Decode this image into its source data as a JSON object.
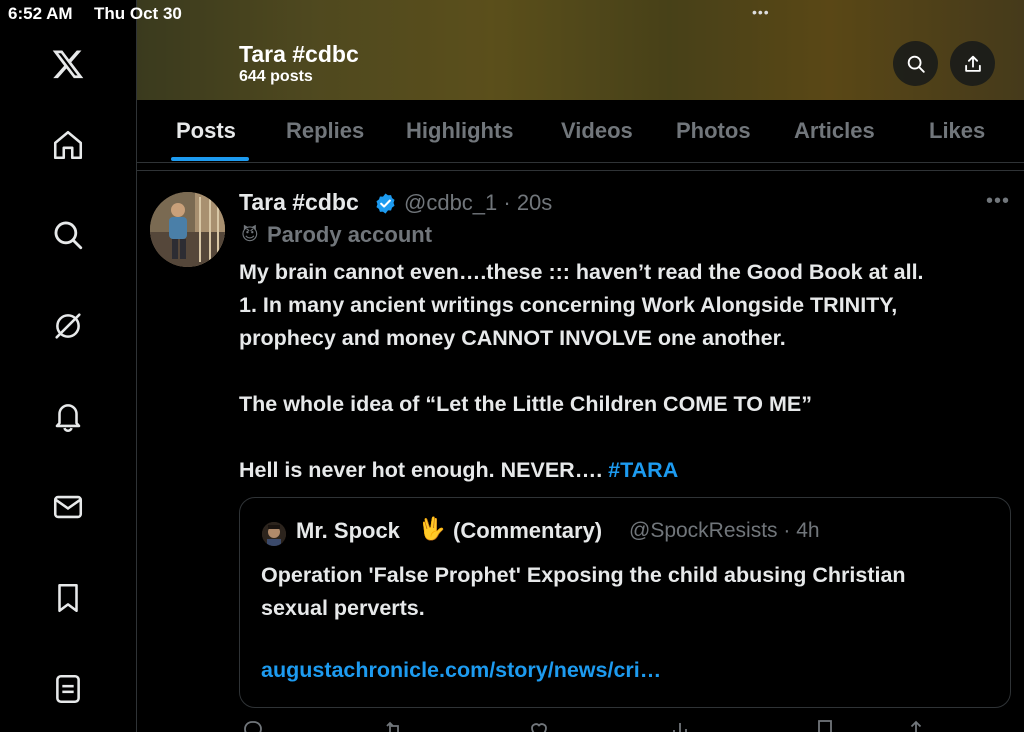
{
  "status_bar": {
    "time": "6:52 AM",
    "date": "Thu Oct 30",
    "dots": "•••"
  },
  "sidebar": {
    "items": [
      {
        "icon": "x-logo-icon"
      },
      {
        "icon": "home-icon"
      },
      {
        "icon": "search-icon"
      },
      {
        "icon": "grok-icon"
      },
      {
        "icon": "bell-icon"
      },
      {
        "icon": "mail-icon"
      },
      {
        "icon": "bookmark-icon"
      },
      {
        "icon": "lists-icon"
      }
    ]
  },
  "header": {
    "title": "Tara #cdbc",
    "post_count": "644 posts"
  },
  "tabs": [
    "Posts",
    "Replies",
    "Highlights",
    "Videos",
    "Photos",
    "Articles",
    "Likes"
  ],
  "active_tab": "Posts",
  "post": {
    "display_name": "Tara #cdbc",
    "handle_time": "@cdbc_1 · 20s",
    "label_icon": "😈",
    "label": "Parody account",
    "more": "•••",
    "text_lines": [
      "My brain cannot even….these ::: haven’t read the Good Book at all.",
      "1. In many ancient writings concerning Work Alongside TRINITY,",
      "prophecy and money CANNOT INVOLVE one another.",
      "",
      "The whole idea of “Let the Little Children COME TO ME”",
      "",
      "Hell is never hot enough. NEVER…. "
    ],
    "hashtag": "#TARA",
    "quote": {
      "name": "Mr. Spock",
      "hand_emoji": "🖖",
      "suffix": "(Commentary)",
      "handle_time": "@SpockResists · 4h",
      "text_lines": [
        "Operation 'False Prophet' Exposing the child abusing Christian",
        "sexual perverts."
      ],
      "link": "augustachronicle.com/story/news/cri…"
    }
  },
  "colors": {
    "accent": "#1d9bf0",
    "muted": "#71767b",
    "text": "#e7e9ea",
    "border": "#2f3336"
  }
}
